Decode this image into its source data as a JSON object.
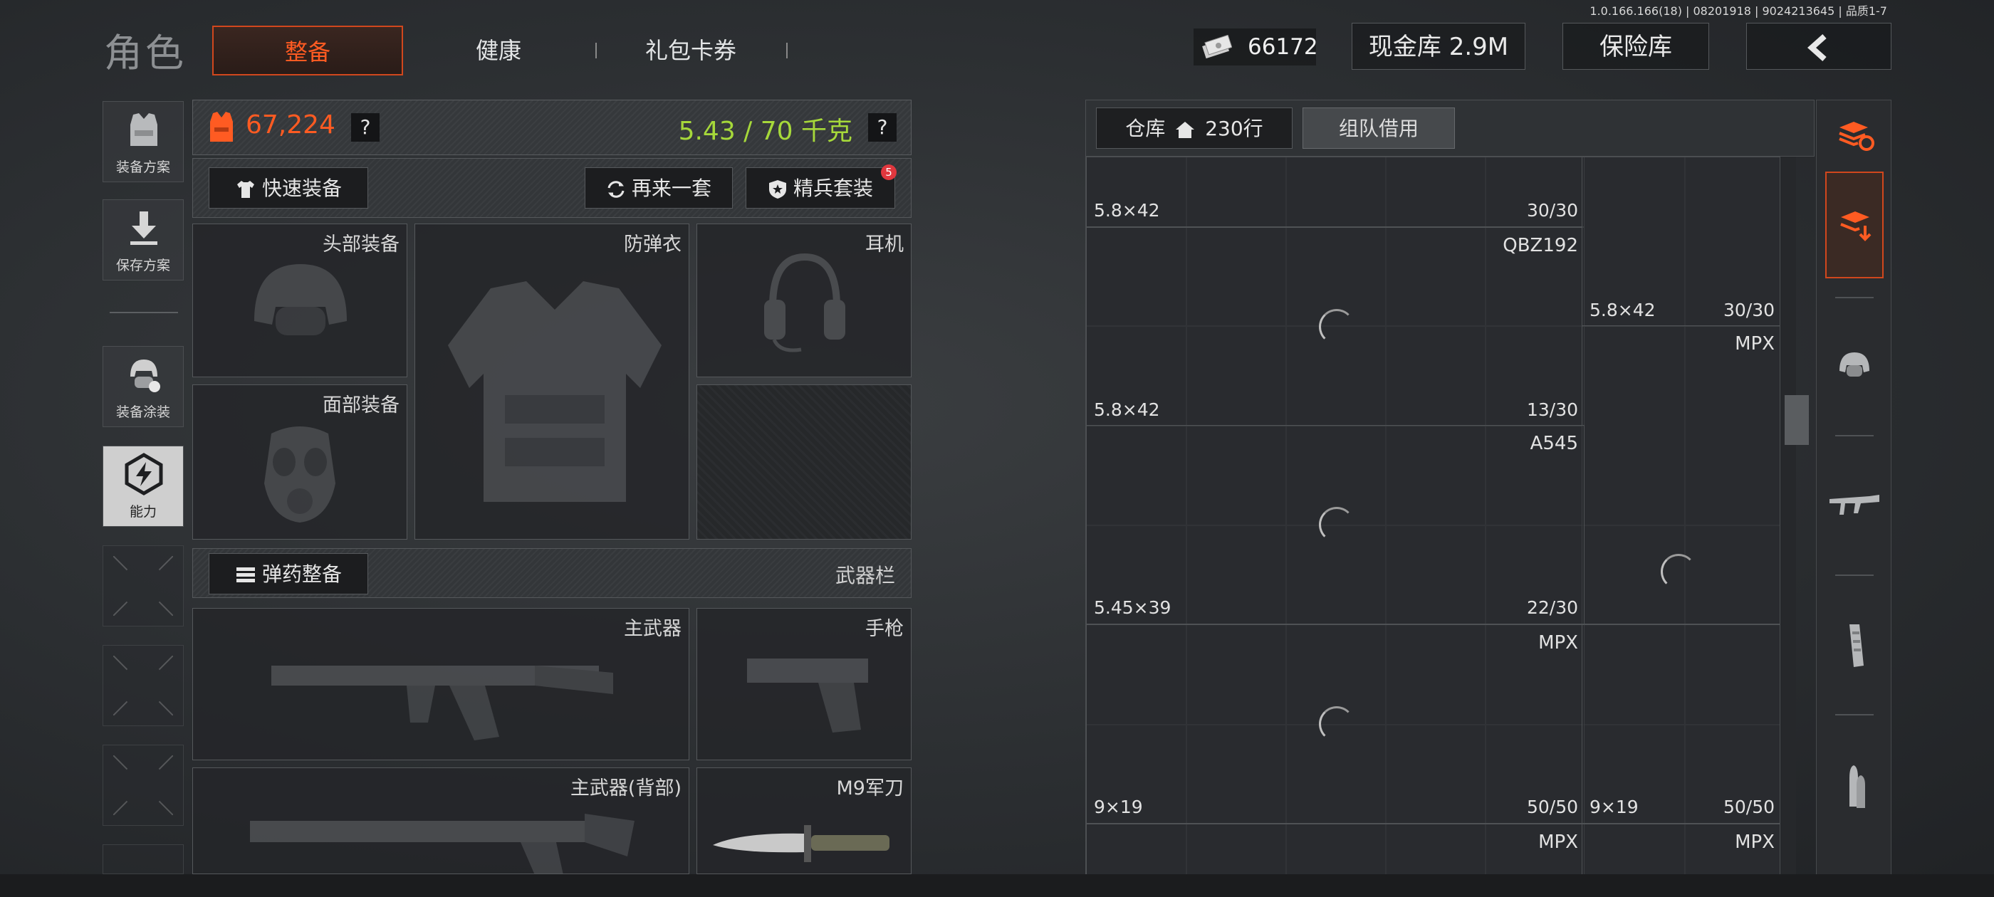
{
  "version": "1.0.166.166(18) | 08201918 | 9024213645 | 品质1-7",
  "header": {
    "title": "角色",
    "tabs": [
      {
        "label": "整备",
        "active": true
      },
      {
        "label": "健康",
        "active": false
      },
      {
        "label": "礼包卡券",
        "active": false
      }
    ],
    "cash": "66172",
    "cash_vault": "现金库 2.9M",
    "safe_box": "保险库",
    "back_icon": "chevron-left-icon"
  },
  "left_nav": [
    {
      "label": "装备方案",
      "icon": "vest-icon"
    },
    {
      "label": "保存方案",
      "icon": "download-icon"
    },
    {
      "label": "装备涂装",
      "icon": "helmet-paint-icon"
    },
    {
      "label": "能力",
      "icon": "lightning-hex-icon",
      "active": true
    }
  ],
  "gear": {
    "value": "67,224",
    "weight": "5.43 / 70 千克",
    "help": "?",
    "quick_equip": "快速装备",
    "again": "再来一套",
    "elite_set": "精兵套装",
    "elite_badge": "5",
    "slots": {
      "head": "头部装备",
      "armor": "防弹衣",
      "headset": "耳机",
      "face": "面部装备"
    },
    "ammo_equip": "弹药整备",
    "weapon_bar": "武器栏",
    "weapons": {
      "primary": "主武器",
      "pistol": "手枪",
      "primary_back": "主武器(背部)",
      "knife": "M9军刀"
    }
  },
  "warehouse": {
    "tab_label": "仓库",
    "rows": "230行",
    "team_borrow": "组队借用",
    "items": [
      {
        "name": "",
        "caliber": "5.8×42",
        "count": "30/30"
      },
      {
        "name": "QBZ192",
        "caliber": "5.8×42",
        "count": "13/30"
      },
      {
        "name": "",
        "caliber": "5.8×42",
        "count": "30/30"
      },
      {
        "name": "MPX",
        "caliber": "",
        "count": ""
      },
      {
        "name": "A545",
        "caliber": "5.45×39",
        "count": "22/30"
      },
      {
        "name": "MPX",
        "caliber": "9×19",
        "count": "50/50"
      },
      {
        "name": "",
        "caliber": "9×19",
        "count": "50/50"
      },
      {
        "name": "MPX",
        "caliber": "",
        "count": ""
      },
      {
        "name": "MPX",
        "caliber": "",
        "count": ""
      }
    ]
  },
  "right_rail": [
    {
      "icon": "stack-refresh-icon"
    },
    {
      "icon": "stack-download-icon",
      "active": true
    },
    {
      "icon": "helmet-icon"
    },
    {
      "icon": "rifle-icon"
    },
    {
      "icon": "magazine-icon"
    },
    {
      "icon": "ammo-icon"
    }
  ],
  "colors": {
    "accent": "#ff5b22",
    "weight": "#a6d83a",
    "badge": "#e0373e"
  }
}
